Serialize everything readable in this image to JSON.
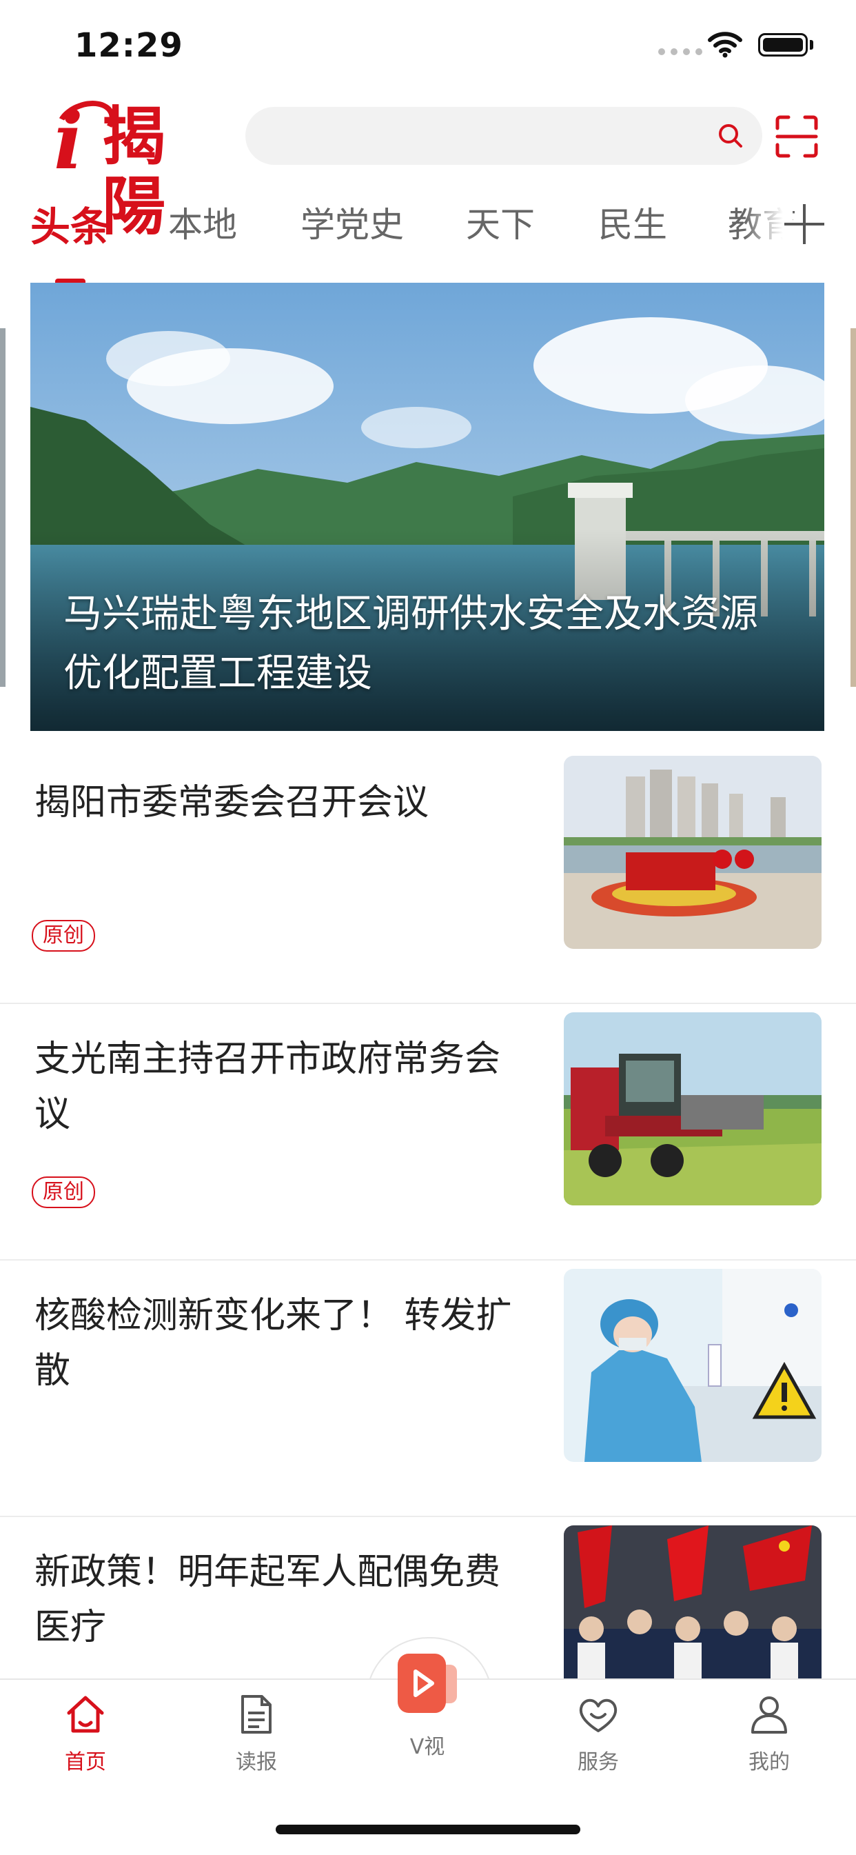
{
  "status_bar": {
    "time": "12:29"
  },
  "header": {
    "logo_text": "揭陽",
    "search": {
      "placeholder": ""
    }
  },
  "tabs": [
    {
      "label": "头条",
      "active": true
    },
    {
      "label": "本地"
    },
    {
      "label": "学党史"
    },
    {
      "label": "天下"
    },
    {
      "label": "民生"
    },
    {
      "label": "教育"
    }
  ],
  "banner": {
    "title": "马兴瑞赴粤东地区调研供水安全及水资源优化配置工程建设"
  },
  "news": [
    {
      "title": "揭阳市委常委会召开会议",
      "badge": "原创"
    },
    {
      "title": "支光南主持召开市政府常务会议",
      "badge": "原创"
    },
    {
      "title": "核酸检测新变化来了！ 转发扩散"
    },
    {
      "title": "新政策！明年起军人配偶免费医疗"
    }
  ],
  "bottom_nav": [
    {
      "label": "首页",
      "icon": "home-icon",
      "active": true
    },
    {
      "label": "读报",
      "icon": "newspaper-icon"
    },
    {
      "label": "V视",
      "icon": "video-icon"
    },
    {
      "label": "服务",
      "icon": "heart-service-icon"
    },
    {
      "label": "我的",
      "icon": "profile-icon"
    }
  ],
  "colors": {
    "brand_red": "#d7101b",
    "tab_gray": "#666666",
    "divider": "#ececec"
  }
}
